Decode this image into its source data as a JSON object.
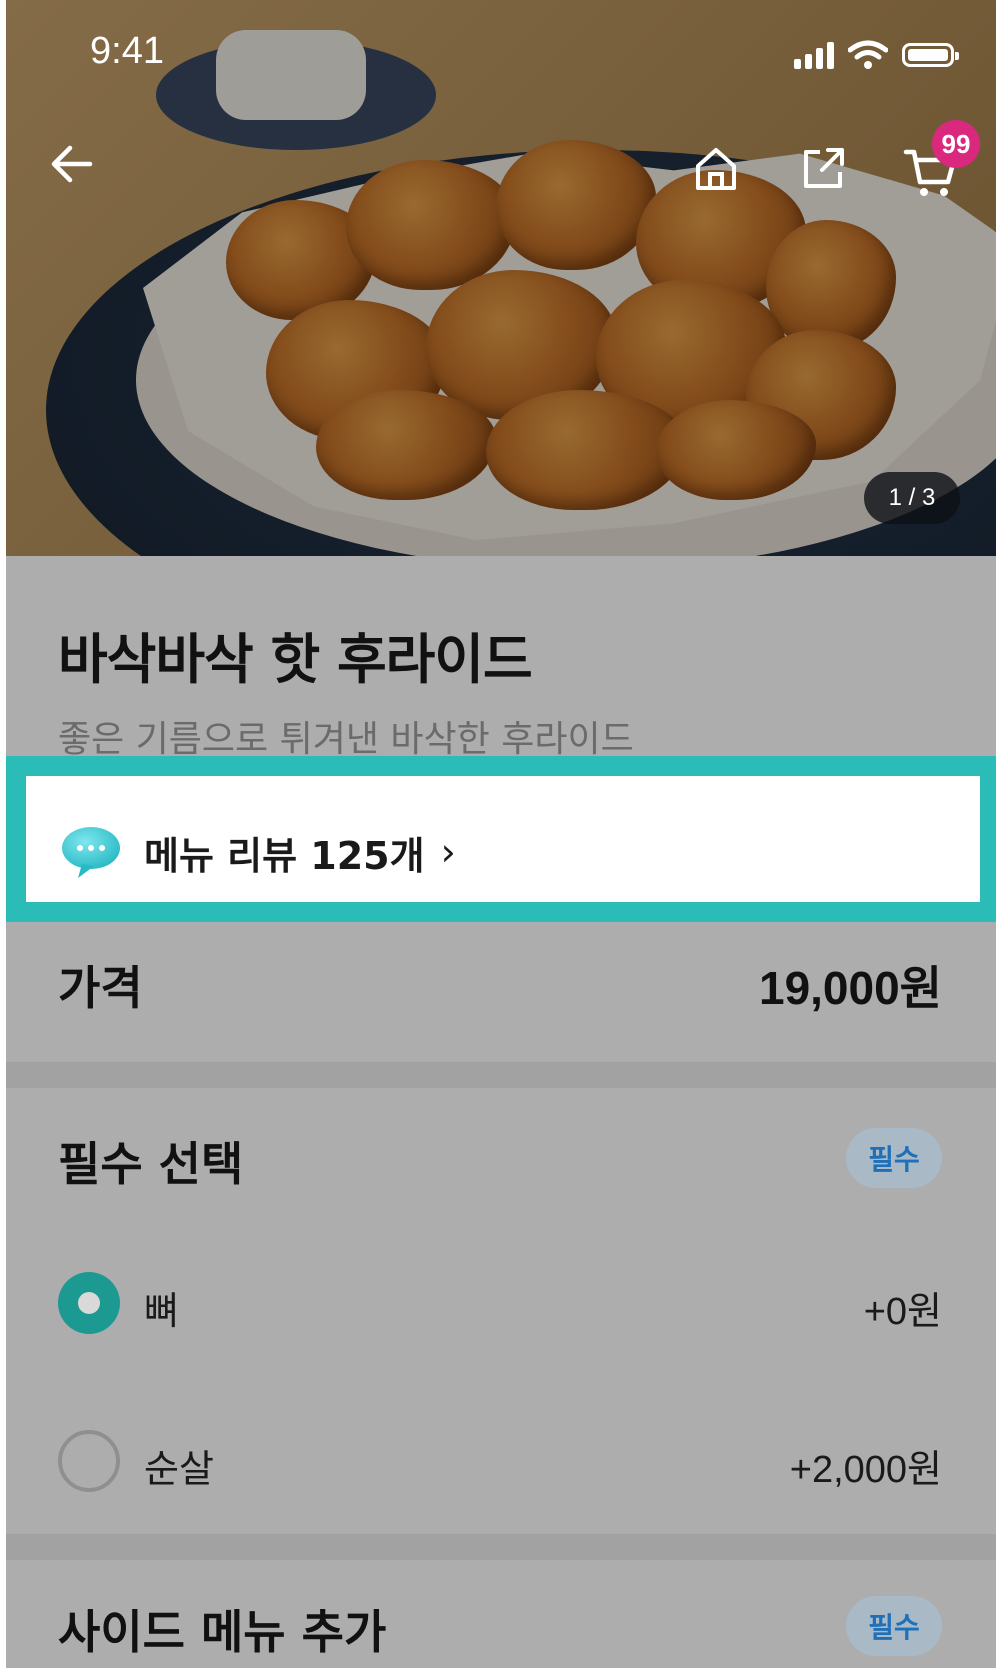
{
  "status_bar": {
    "time": "9:41"
  },
  "hero": {
    "page_indicator": "1 / 3",
    "cart_badge_count": "99",
    "icons": [
      "arrow-left-icon",
      "home-icon",
      "share-icon",
      "cart-icon"
    ]
  },
  "menu": {
    "title": "바삭바삭 핫 후라이드",
    "description": "좋은 기름으로 튀겨낸 바삭한 후라이드",
    "review_label": "메뉴 리뷰 125개",
    "review_icon": "speech-bubble-icon"
  },
  "price": {
    "label": "가격",
    "value": "19,000원"
  },
  "required_choice": {
    "title": "필수 선택",
    "badge": "필수",
    "options": [
      {
        "label": "뼈",
        "price": "+0원",
        "selected": true
      },
      {
        "label": "순살",
        "price": "+2,000원",
        "selected": false
      }
    ]
  },
  "side_menu": {
    "title": "사이드 메뉴 추가",
    "badge": "필수"
  },
  "colors": {
    "highlight_border": "#2cbcb8",
    "selected_radio": "#1c9a92",
    "cart_badge": "#d9287d",
    "required_badge_text": "#1f6fb9"
  }
}
